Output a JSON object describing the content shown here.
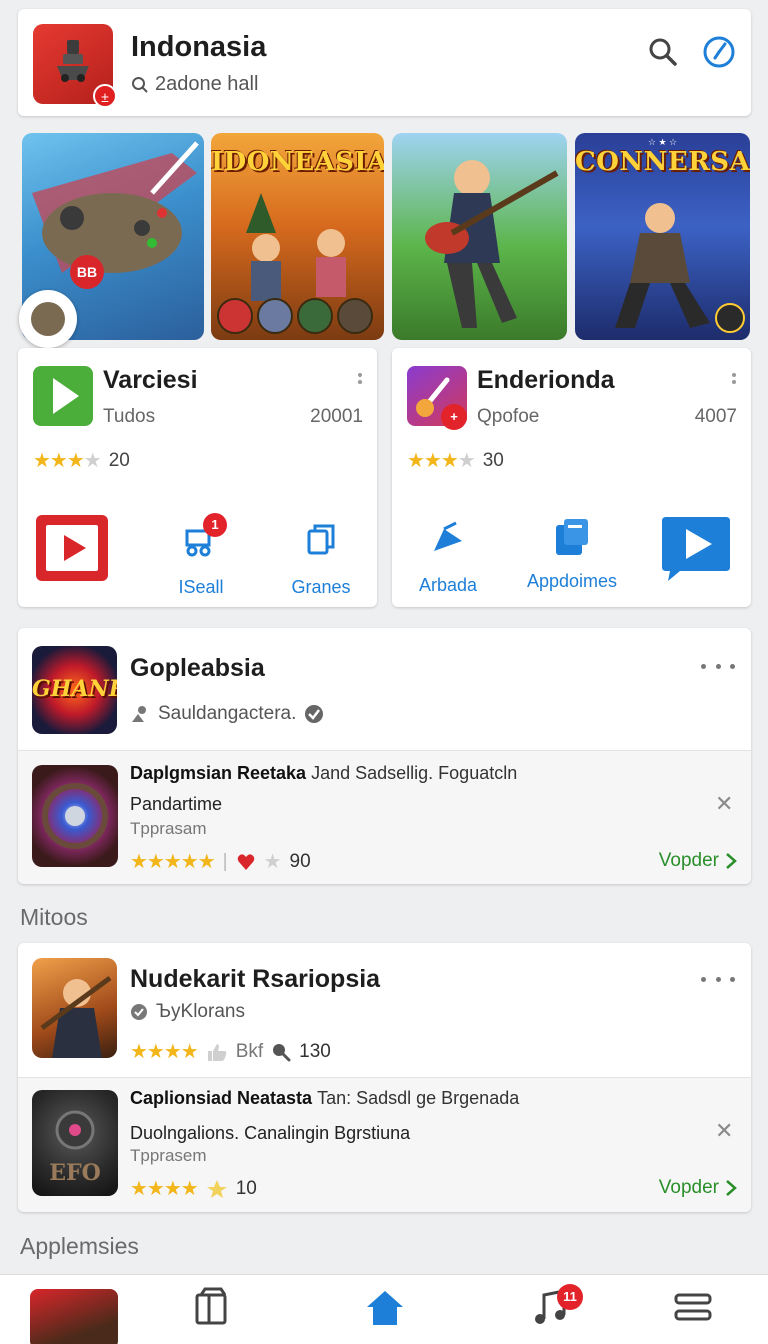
{
  "header": {
    "title": "Indonasia",
    "subtitle": "2adone hall",
    "icon_badge": "±"
  },
  "banners": [
    {
      "name": "controller-promo",
      "badge": "BB"
    },
    {
      "name": "indonesia-game",
      "title": "IDONEASIA"
    },
    {
      "name": "guitar-hero-game"
    },
    {
      "name": "connersah-game",
      "title": "CONNERSAH"
    }
  ],
  "app_cards": [
    {
      "name": "Varciesi",
      "category": "Tudos",
      "number": "20001",
      "rating_count": "20",
      "actions": [
        {
          "label": ""
        },
        {
          "label": "ISeall",
          "badge": "1"
        },
        {
          "label": "Granes"
        }
      ]
    },
    {
      "name": "Enderionda",
      "category": "Qpofoe",
      "number": "4007",
      "rating_count": "30",
      "actions": [
        {
          "label": "Arbada"
        },
        {
          "label": "Appdoimes"
        },
        {
          "label": ""
        }
      ]
    }
  ],
  "section1": {
    "title": "Gopleabsia",
    "subtitle": "Sauldangactera.",
    "thumb_text": "GHANR",
    "promo": {
      "title_bold": "Daplgmsian Reetaka",
      "title_light": "Jand Sadsellig. Foguatcln",
      "line2": "Pandartime",
      "category": "Tpprasam",
      "rating_count": "90",
      "cta": "Vopder"
    }
  },
  "section_label_1": "Mitoos",
  "section2": {
    "title": "Nudekarit Rsariopsia",
    "subtitle": "ЪyKlorans",
    "rating_extra": "Bkf",
    "rating_count": "130",
    "promo": {
      "title_bold": "Caplionsiad Neatasta",
      "title_light": "Tan: Sadsdl ge Brgenada",
      "line2": "Duolngalions. Canalingin Bgrstiuna",
      "category": "Tpprasem",
      "thumb_text": "EFO",
      "rating_count": "10",
      "cta": "Vopder"
    }
  },
  "section_label_2": "Applemsies",
  "bottom_nav": {
    "music_badge": "11"
  },
  "colors": {
    "accent_blue": "#1e7fd8",
    "red": "#e02020",
    "green_cta": "#2a8f2a",
    "star": "#f2b61b"
  }
}
